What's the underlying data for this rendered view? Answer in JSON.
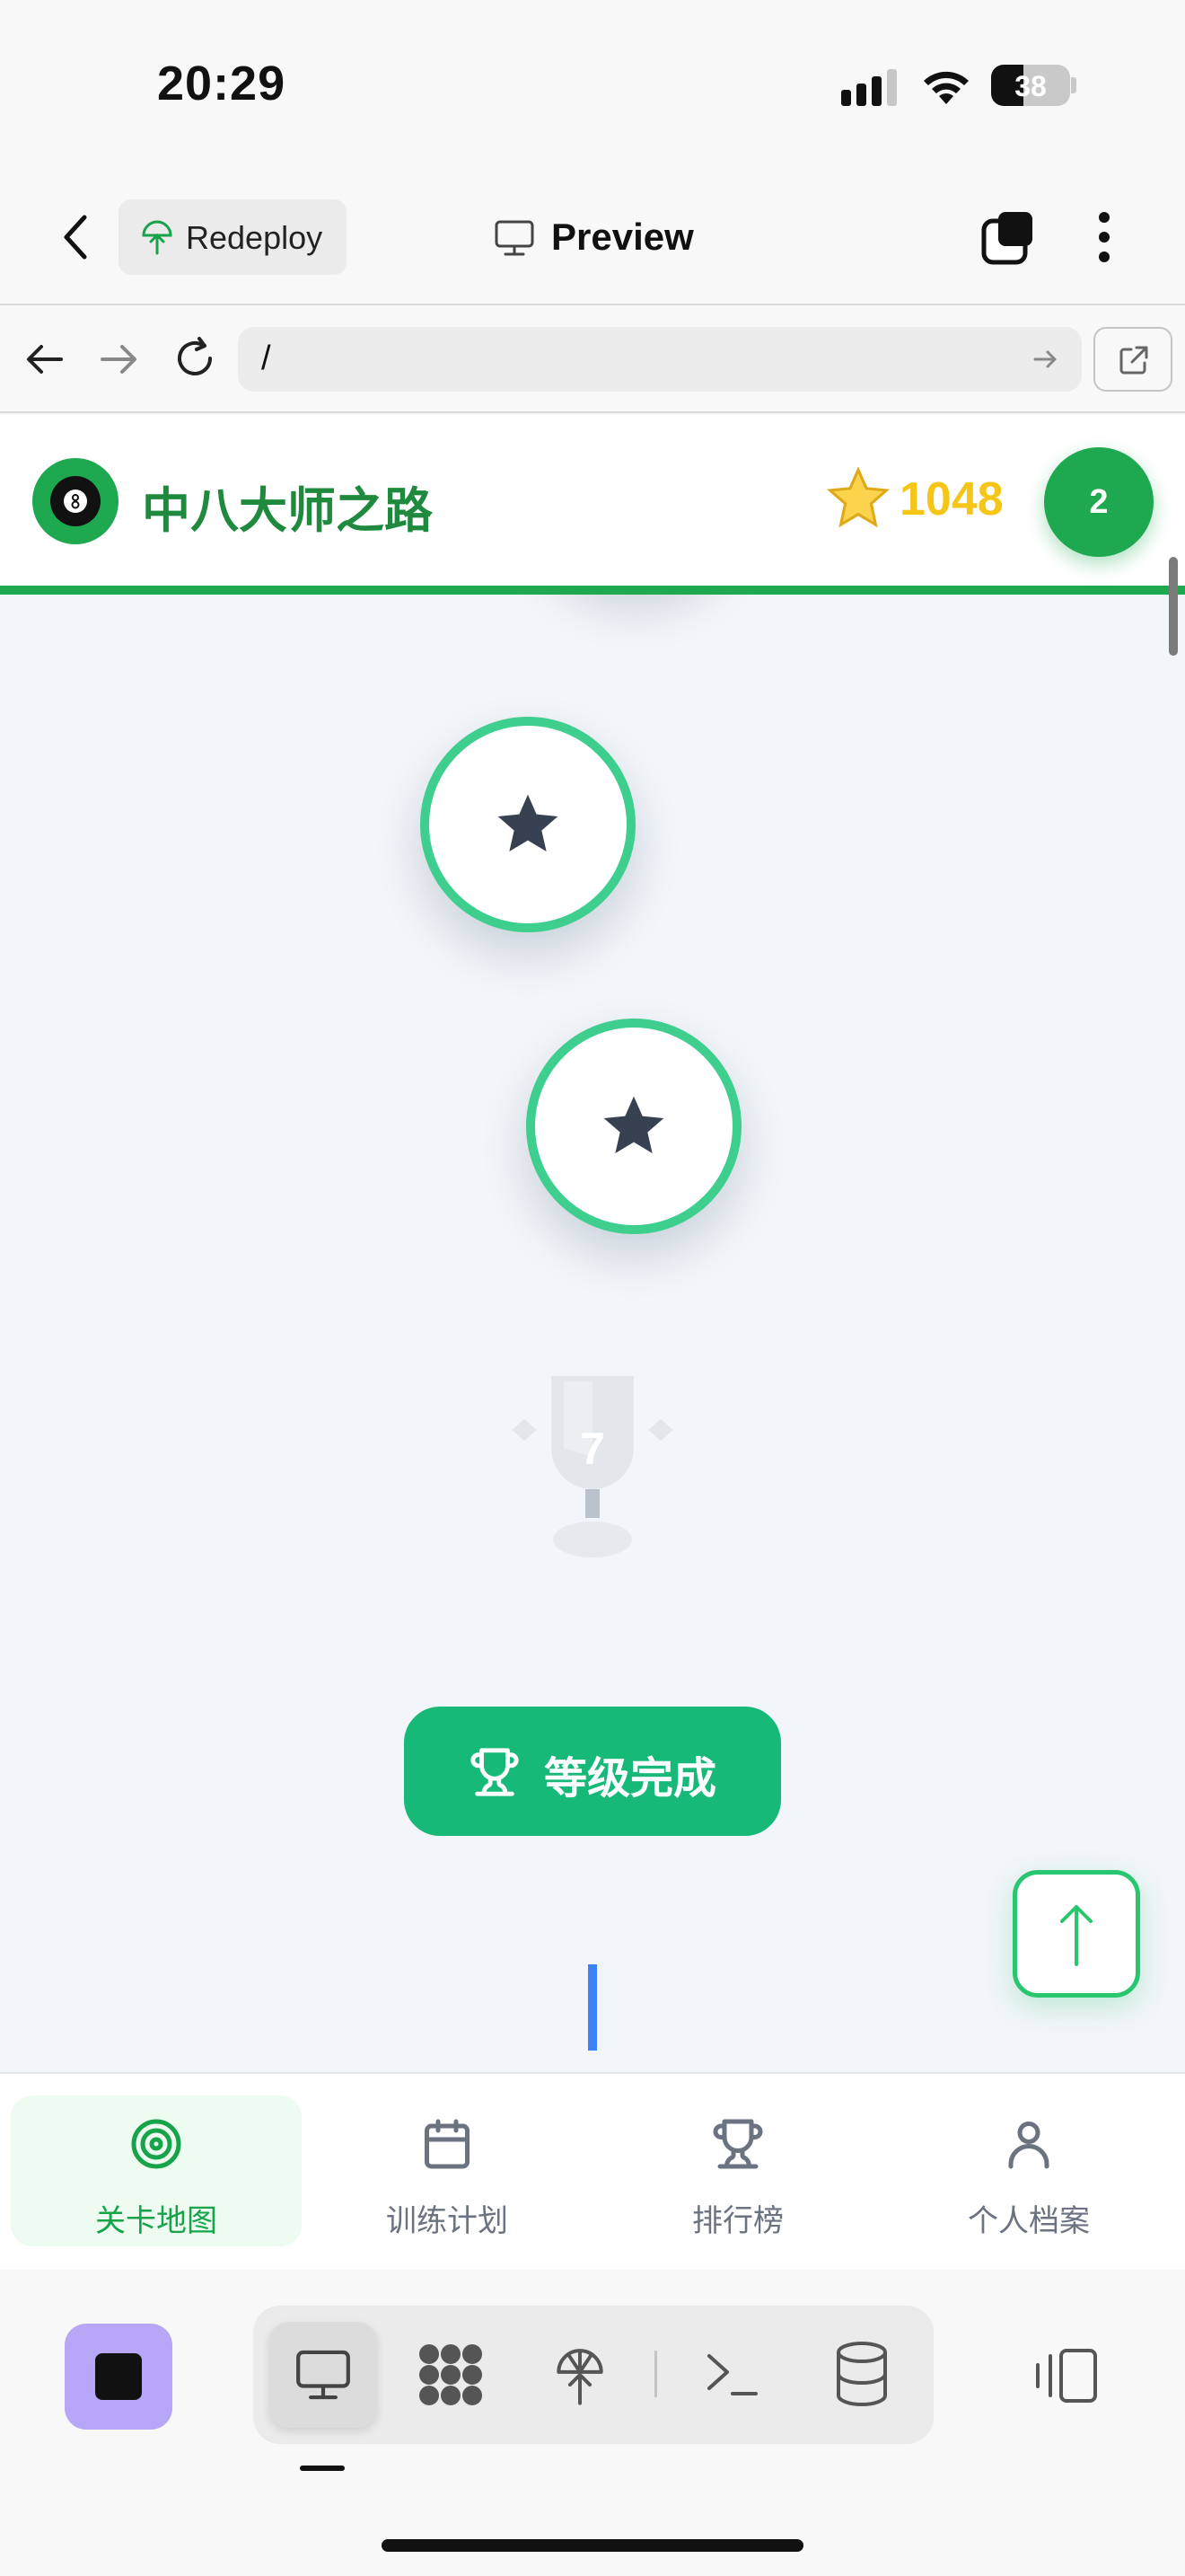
{
  "status": {
    "time": "20:29",
    "battery": "38"
  },
  "app_nav": {
    "redeploy_label": "Redeploy",
    "preview_label": "Preview"
  },
  "browser": {
    "url": "/"
  },
  "site": {
    "title": "中八大师之路",
    "score": "1048",
    "level_badge": "2"
  },
  "map": {
    "trophy_number": "7",
    "complete_button": "等级完成"
  },
  "tabs": [
    {
      "label": "关卡地图",
      "icon": "target-icon",
      "active": true
    },
    {
      "label": "训练计划",
      "icon": "calendar-icon",
      "active": false
    },
    {
      "label": "排行榜",
      "icon": "trophy-icon",
      "active": false
    },
    {
      "label": "个人档案",
      "icon": "user-icon",
      "active": false
    }
  ],
  "colors": {
    "brand_green": "#1ea84f",
    "node_ring": "#3ecf8e",
    "button_green": "#17b978",
    "score_gold": "#f5c518",
    "dev_purple": "#b8a6f7"
  }
}
